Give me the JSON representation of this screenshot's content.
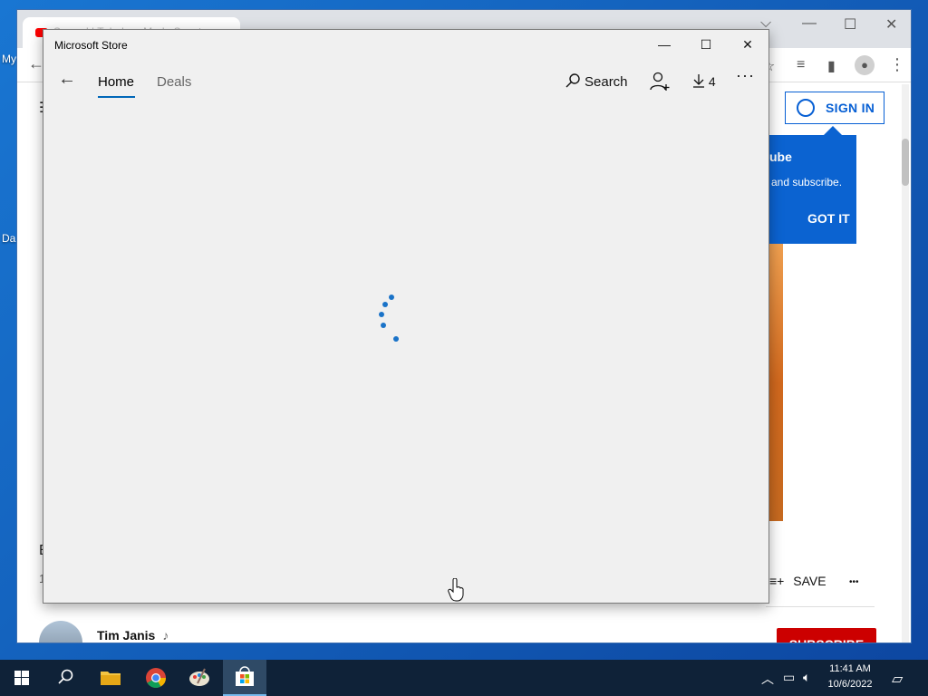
{
  "desktop": {
    "icon_labels": [
      "My",
      "Da"
    ]
  },
  "chrome": {
    "tab_title": "Surreal | Tubular - Marla Scout...",
    "tab_new": "+",
    "window_controls": {
      "dropdown": "⌵",
      "minimize": "—",
      "maximize": "☐",
      "close": "✕"
    },
    "toolbar_icons": [
      "back-icon",
      "star-icon",
      "media-control-icon",
      "side-panel-icon",
      "profile-icon",
      "menu-icon"
    ],
    "menu_glyph": "⋮",
    "back_glyph": "←"
  },
  "youtube": {
    "sign_in_label": "SIGN IN",
    "popup": {
      "title": "ube",
      "text": "and subscribe.",
      "button": "GOT IT"
    },
    "save_label": "SAVE",
    "more_glyph": "•••",
    "channel_name": "Tim Janis",
    "channel_note": "♪",
    "subscribe_label": "SUBSCRIBE",
    "left_stubs": [
      "☰",
      "E",
      "1"
    ]
  },
  "store": {
    "window_title": "Microsoft Store",
    "window_controls": {
      "minimize": "—",
      "maximize": "☐",
      "close": "✕"
    },
    "nav": {
      "back_glyph": "←",
      "tabs": [
        {
          "label": "Home",
          "active": true
        },
        {
          "label": "Deals",
          "active": false
        }
      ],
      "search_label": "Search",
      "downloads_count": "4",
      "more_glyph": "···"
    },
    "loading": true
  },
  "taskbar": {
    "apps": [
      "windows-start",
      "search",
      "file-explorer",
      "chrome",
      "paint",
      "microsoft-store"
    ],
    "active_app": "microsoft-store",
    "clock_time": "11:41 AM",
    "clock_date": "10/6/2022",
    "tray_icons": [
      "chevron-up-icon",
      "network-icon",
      "volume-icon",
      "notification-icon"
    ]
  },
  "colors": {
    "store_accent": "#0067b8",
    "youtube_blue": "#065fd4",
    "youtube_red": "#cc0000",
    "taskbar_bg": "#0f2238"
  }
}
